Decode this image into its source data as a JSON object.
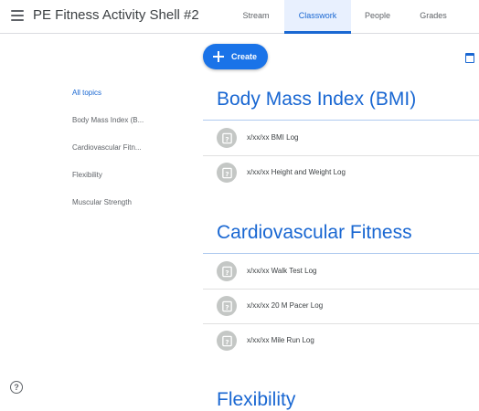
{
  "header": {
    "title": "PE Fitness Activity Shell #2",
    "tabs": [
      {
        "label": "Stream",
        "active": false
      },
      {
        "label": "Classwork",
        "active": true
      },
      {
        "label": "People",
        "active": false
      },
      {
        "label": "Grades",
        "active": false
      }
    ]
  },
  "toolbar": {
    "create_label": "Create"
  },
  "sidebar": {
    "items": [
      {
        "label": "All topics",
        "active": true
      },
      {
        "label": "Body Mass Index (B...",
        "active": false
      },
      {
        "label": "Cardiovascular Fitn...",
        "active": false
      },
      {
        "label": "Flexibility",
        "active": false
      },
      {
        "label": "Muscular Strength",
        "active": false
      }
    ]
  },
  "topics": [
    {
      "title": "Body Mass Index (BMI)",
      "assignments": [
        {
          "label": "x/xx/xx BMI Log",
          "icon": "assignment-question-icon"
        },
        {
          "label": "x/xx/xx Height and Weight Log",
          "icon": "assignment-question-icon"
        }
      ]
    },
    {
      "title": "Cardiovascular Fitness",
      "assignments": [
        {
          "label": "x/xx/xx Walk Test Log",
          "icon": "assignment-question-icon"
        },
        {
          "label": "x/xx/xx 20 M Pacer Log",
          "icon": "assignment-question-icon"
        },
        {
          "label": "x/xx/xx Mile Run Log",
          "icon": "assignment-question-icon"
        }
      ]
    },
    {
      "title": "Flexibility",
      "assignments": []
    }
  ],
  "colors": {
    "accent": "#1967d2",
    "create_button": "#1a73e8",
    "icon_gray": "#c4c7c5"
  },
  "icons": {
    "menu": "hamburger-menu-icon",
    "calendar": "calendar-icon",
    "help": "help-icon",
    "help_glyph": "?"
  }
}
